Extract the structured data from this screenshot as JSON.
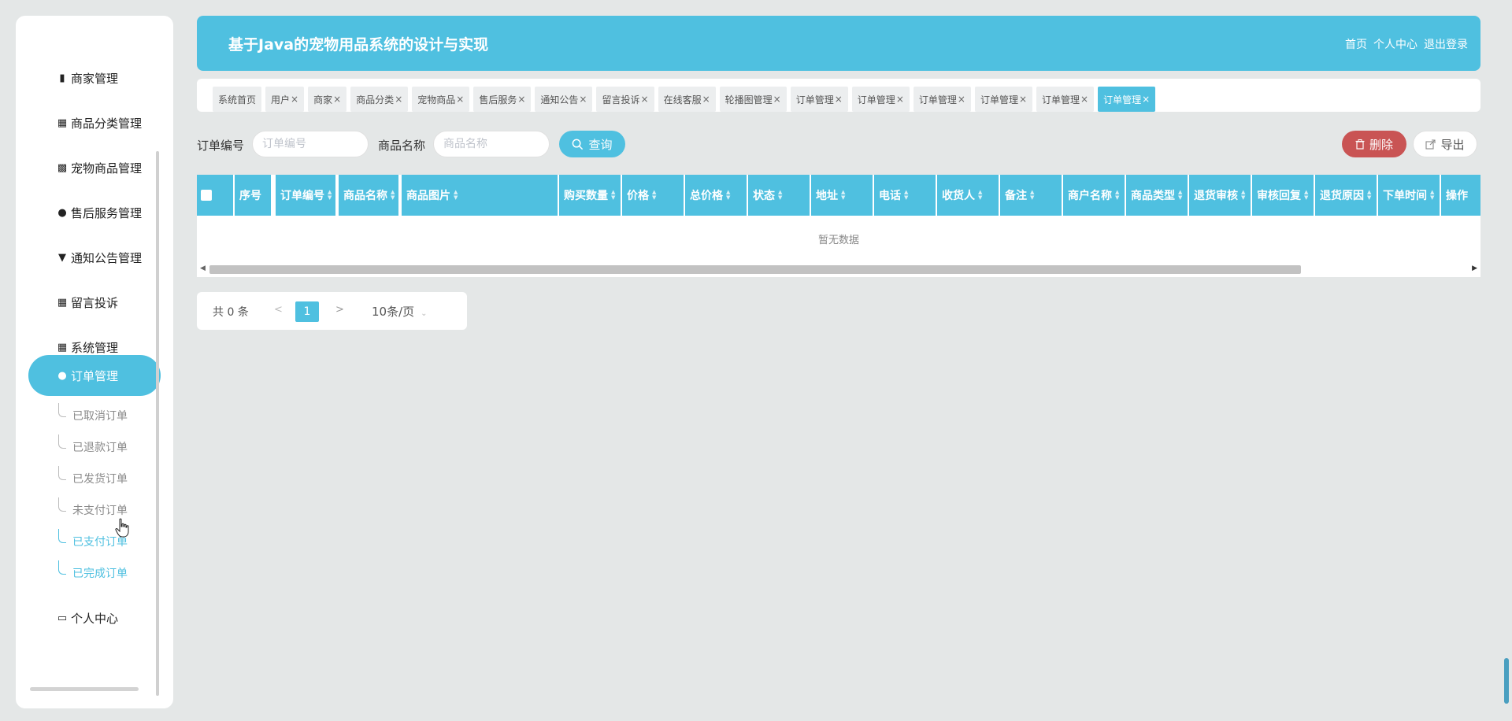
{
  "header": {
    "title": "基于Java的宠物用品系统的设计与实现",
    "links": [
      "首页",
      "个人中心",
      "退出登录"
    ]
  },
  "sidebar": {
    "items": [
      {
        "label": "商家管理",
        "icon": "clipboard-icon"
      },
      {
        "label": "商品分类管理",
        "icon": "grid-icon"
      },
      {
        "label": "宠物商品管理",
        "icon": "bar-chart-icon"
      },
      {
        "label": "售后服务管理",
        "icon": "user-icon"
      },
      {
        "label": "通知公告管理",
        "icon": "brush-icon"
      },
      {
        "label": "留言投诉",
        "icon": "grid-icon"
      },
      {
        "label": "系统管理",
        "icon": "grid-icon"
      },
      {
        "label": "订单管理",
        "icon": "user-icon"
      },
      {
        "label": "个人中心",
        "icon": "card-icon"
      }
    ],
    "active_index": 7,
    "sub_items": [
      "已取消订单",
      "已退款订单",
      "已发货订单",
      "未支付订单",
      "已支付订单",
      "已完成订单"
    ]
  },
  "tabs": [
    {
      "label": "系统首页",
      "closable": false
    },
    {
      "label": "用户",
      "closable": true
    },
    {
      "label": "商家",
      "closable": true
    },
    {
      "label": "商品分类",
      "closable": true
    },
    {
      "label": "宠物商品",
      "closable": true
    },
    {
      "label": "售后服务",
      "closable": true
    },
    {
      "label": "通知公告",
      "closable": true
    },
    {
      "label": "留言投诉",
      "closable": true
    },
    {
      "label": "在线客服",
      "closable": true
    },
    {
      "label": "轮播图管理",
      "closable": true
    },
    {
      "label": "订单管理",
      "closable": true
    },
    {
      "label": "订单管理",
      "closable": true
    },
    {
      "label": "订单管理",
      "closable": true
    },
    {
      "label": "订单管理",
      "closable": true
    },
    {
      "label": "订单管理",
      "closable": true
    },
    {
      "label": "订单管理",
      "closable": true,
      "active": true
    }
  ],
  "search": {
    "order_no_label": "订单编号",
    "order_no_placeholder": "订单编号",
    "product_name_label": "商品名称",
    "product_name_placeholder": "商品名称",
    "query_button": "查询",
    "delete_button": "删除",
    "export_button": "导出"
  },
  "table": {
    "columns": [
      "序号",
      "订单编号",
      "商品名称",
      "商品图片",
      "购买数量",
      "价格",
      "总价格",
      "状态",
      "地址",
      "电话",
      "收货人",
      "备注",
      "商户名称",
      "商品类型",
      "退货审核",
      "审核回复",
      "退货原因",
      "下单时间",
      "操作"
    ],
    "empty_text": "暂无数据"
  },
  "pagination": {
    "total_text": "共 0 条",
    "prev": "<",
    "current_page": "1",
    "next": ">",
    "page_size": "10条/页"
  },
  "colors": {
    "accent": "#4fc0e0",
    "danger": "#c95454",
    "background": "#e4e7e7"
  }
}
